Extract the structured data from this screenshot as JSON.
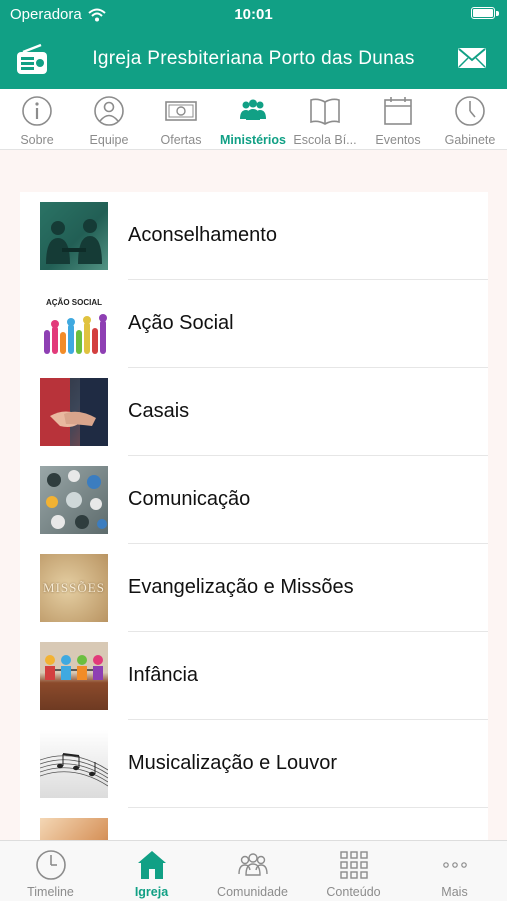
{
  "status_bar": {
    "carrier": "Operadora",
    "time": "10:01"
  },
  "header": {
    "title": "Igreja Presbiteriana Porto das Dunas"
  },
  "top_tabs": [
    {
      "label": "Sobre",
      "icon": "info-icon"
    },
    {
      "label": "Equipe",
      "icon": "person-icon"
    },
    {
      "label": "Ofertas",
      "icon": "banknote-icon"
    },
    {
      "label": "Ministérios",
      "icon": "group-icon",
      "active": true
    },
    {
      "label": "Escola Bí...",
      "icon": "book-icon"
    },
    {
      "label": "Eventos",
      "icon": "calendar-icon"
    },
    {
      "label": "Gabinete",
      "icon": "clock-icon"
    }
  ],
  "ministries": [
    {
      "name": "Aconselhamento",
      "thumb_caption": ""
    },
    {
      "name": "Ação Social",
      "thumb_caption": "AÇÃO SOCIAL"
    },
    {
      "name": "Casais",
      "thumb_caption": ""
    },
    {
      "name": "Comunicação",
      "thumb_caption": ""
    },
    {
      "name": "Evangelização e Missões",
      "thumb_caption": "MISSÕES"
    },
    {
      "name": "Infância",
      "thumb_caption": ""
    },
    {
      "name": "Musicalização e Louvor",
      "thumb_caption": ""
    }
  ],
  "bottom_tabs": [
    {
      "label": "Timeline",
      "icon": "clock-icon"
    },
    {
      "label": "Igreja",
      "icon": "church-icon",
      "active": true
    },
    {
      "label": "Comunidade",
      "icon": "community-icon"
    },
    {
      "label": "Conteúdo",
      "icon": "grid-icon"
    },
    {
      "label": "Mais",
      "icon": "more-dots-icon"
    }
  ],
  "colors": {
    "accent": "#11a085",
    "inactive": "#8c8c8c"
  }
}
